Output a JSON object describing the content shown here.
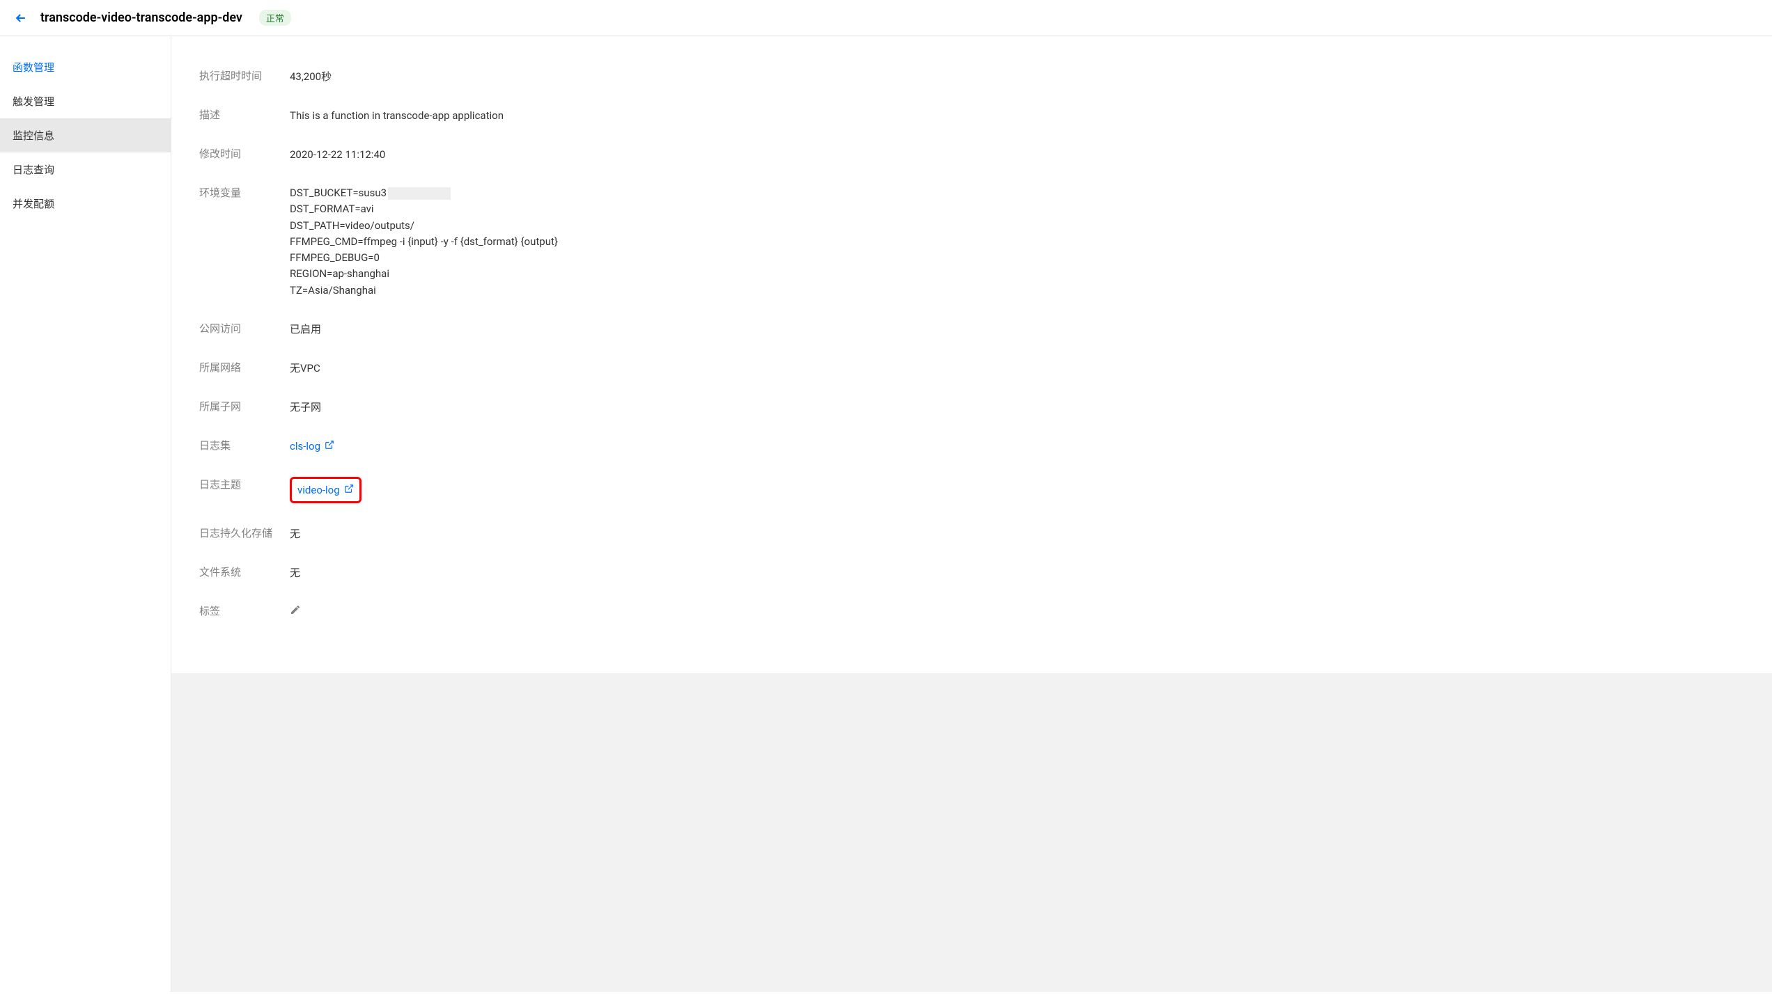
{
  "header": {
    "title": "transcode-video-transcode-app-dev",
    "status": "正常"
  },
  "sidebar": {
    "items": [
      {
        "label": "函数管理",
        "style": "blue"
      },
      {
        "label": "触发管理",
        "style": ""
      },
      {
        "label": "监控信息",
        "style": "active"
      },
      {
        "label": "日志查询",
        "style": ""
      },
      {
        "label": "并发配额",
        "style": ""
      }
    ]
  },
  "details": {
    "timeout": {
      "label": "执行超时时间",
      "value": "43,200秒"
    },
    "description": {
      "label": "描述",
      "value": "This is a function in transcode-app application"
    },
    "modified": {
      "label": "修改时间",
      "value": "2020-12-22 11:12:40"
    },
    "env": {
      "label": "环境变量",
      "lines": [
        "DST_BUCKET=susu3",
        "DST_FORMAT=avi",
        "DST_PATH=video/outputs/",
        "FFMPEG_CMD=ffmpeg -i {input} -y -f {dst_format} {output}",
        "FFMPEG_DEBUG=0",
        "REGION=ap-shanghai",
        "TZ=Asia/Shanghai"
      ]
    },
    "public_access": {
      "label": "公网访问",
      "value": "已启用"
    },
    "network": {
      "label": "所属网络",
      "value": "无VPC"
    },
    "subnet": {
      "label": "所属子网",
      "value": "无子网"
    },
    "logset": {
      "label": "日志集",
      "value": "cls-log"
    },
    "logtopic": {
      "label": "日志主题",
      "value": "video-log"
    },
    "log_persist": {
      "label": "日志持久化存储",
      "value": "无"
    },
    "filesystem": {
      "label": "文件系统",
      "value": "无"
    },
    "tags": {
      "label": "标签"
    }
  }
}
